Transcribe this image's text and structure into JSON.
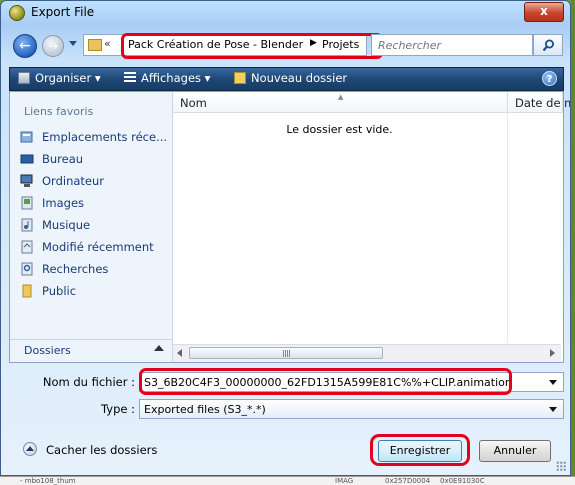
{
  "window": {
    "title": "Export File",
    "close_label": "x"
  },
  "nav": {
    "breadcrumb_prefix": "«",
    "breadcrumbs": [
      "Pack Création de Pose - Blender",
      "Projets"
    ],
    "search_placeholder": "Rechercher"
  },
  "toolbar": {
    "organize": "Organiser",
    "views": "Affichages",
    "new_folder": "Nouveau dossier",
    "help": "?"
  },
  "sidebar": {
    "heading": "Liens favoris",
    "items": [
      {
        "label": "Emplacements réce...",
        "icon": "recent-places-icon"
      },
      {
        "label": "Bureau",
        "icon": "desktop-icon"
      },
      {
        "label": "Ordinateur",
        "icon": "computer-icon"
      },
      {
        "label": "Images",
        "icon": "pictures-icon"
      },
      {
        "label": "Musique",
        "icon": "music-icon"
      },
      {
        "label": "Modifié récemment",
        "icon": "recently-changed-icon"
      },
      {
        "label": "Recherches",
        "icon": "searches-icon"
      },
      {
        "label": "Public",
        "icon": "public-folder-icon"
      }
    ],
    "folders_label": "Dossiers"
  },
  "file_list": {
    "columns": [
      "Nom",
      "Date de m"
    ],
    "empty_message": "Le dossier est vide."
  },
  "form": {
    "filename_label": "Nom du fichier :",
    "filename_value": "S3_6B20C4F3_00000000_62FD1315A599E81C%%+CLIP.animation",
    "type_label": "Type :",
    "type_value": "Exported files (S3_*.*)"
  },
  "footer": {
    "hide_folders": "Cacher les dossiers",
    "save": "Enregistrer",
    "cancel": "Annuler"
  },
  "background": {
    "row": [
      "- mbo108_thum",
      "IMAG",
      "0x257D0004",
      "0x0E91030C"
    ]
  },
  "colors": {
    "highlight": "#e3001b",
    "toolbar": "#1f4876",
    "link": "#1b3a7a"
  }
}
